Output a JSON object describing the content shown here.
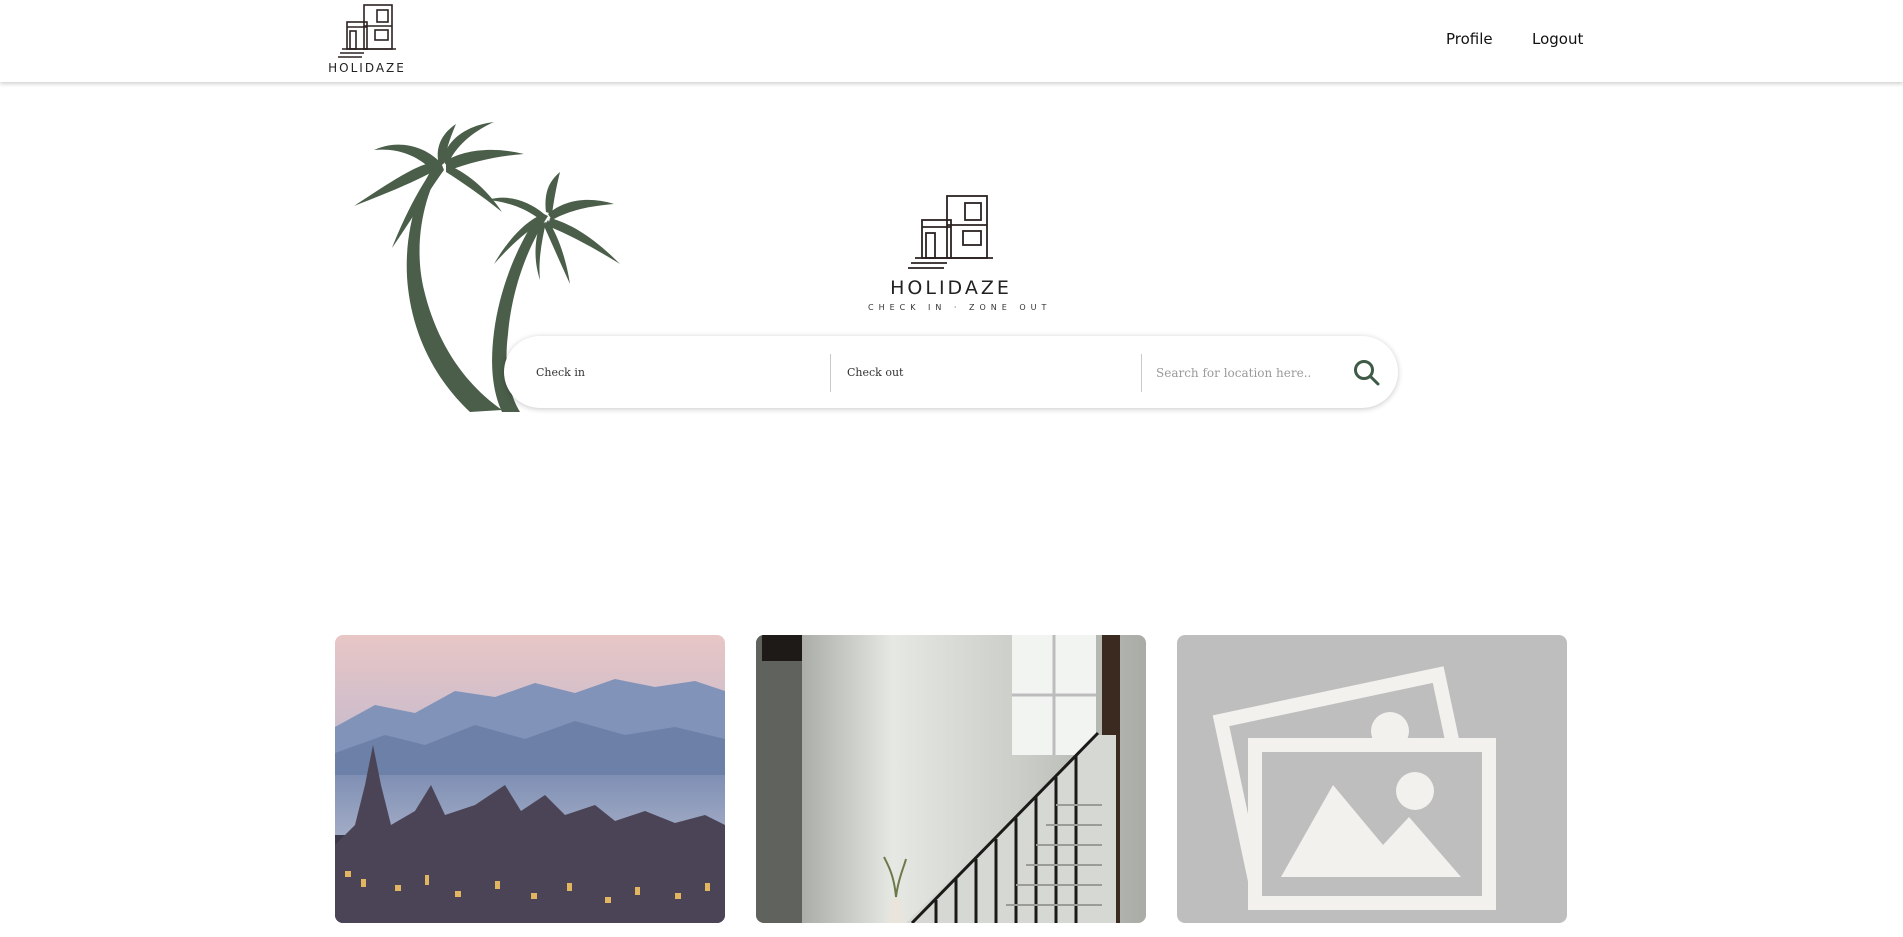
{
  "header": {
    "brand_name": "HOLIDAZE",
    "nav": {
      "profile_label": "Profile",
      "logout_label": "Logout"
    }
  },
  "hero": {
    "logo_title": "HOLIDAZE",
    "logo_tagline": "CHECK IN · ZONE OUT",
    "decoration_icon": "palm-trees-icon",
    "palm_color": "#4a5e4a"
  },
  "search": {
    "checkin_label": "Check in",
    "checkout_label": "Check out",
    "location_placeholder": "Search for location here..",
    "search_icon": "search-icon",
    "accent_color": "#3f5a47"
  },
  "listings": {
    "cards": [
      {
        "image": "castle-town-by-sea-at-dusk"
      },
      {
        "image": "bright-staircase-interior"
      },
      {
        "image": "placeholder-image-icon"
      }
    ]
  }
}
